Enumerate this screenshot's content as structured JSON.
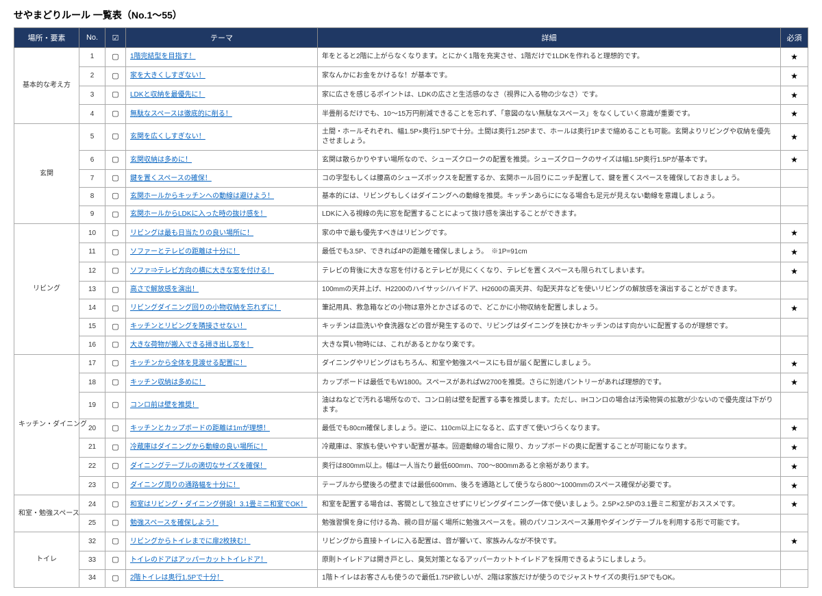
{
  "title": "せやまどりルール 一覧表（No.1〜55）",
  "headers": {
    "category": "場所・要素",
    "no": "No.",
    "check": "☑",
    "theme": "テーマ",
    "detail": "詳細",
    "required": "必須"
  },
  "check_glyph": "▢",
  "star_glyph": "★",
  "sections": [
    {
      "category": "基本的な考え方",
      "rows": [
        {
          "no": "1",
          "theme": "1階完結型を目指す！",
          "detail": "年をとると2階に上がらなくなります。とにかく1階を充実させ、1階だけで1LDKを作れると理想的です。",
          "req": true
        },
        {
          "no": "2",
          "theme": "家を大きくしすぎない！",
          "detail": "家なんかにお金をかけるな！が基本です。",
          "req": true
        },
        {
          "no": "3",
          "theme": "LDKと収納を最優先に！",
          "detail": "家に広さを感じるポイントは、LDKの広さと生活感のなさ（視界に入る物の少なさ）です。",
          "req": true
        },
        {
          "no": "4",
          "theme": "無駄なスペースは徹底的に削る！",
          "detail": "半畳削るだけでも、10〜15万円削減できることを忘れず、「意図のない無駄なスペース」をなくしていく意識が重要です。",
          "req": true
        }
      ]
    },
    {
      "category": "玄関",
      "rows": [
        {
          "no": "5",
          "theme": "玄関を広くしすぎない！",
          "detail": "土間・ホールそれぞれ、幅1.5P×奥行1.5Pで十分。土間は奥行1.25Pまで、ホールは奥行1Pまで縮めることも可能。玄関よりリビングや収納を優先させましょう。",
          "req": true
        },
        {
          "no": "6",
          "theme": "玄関収納は多めに！",
          "detail": "玄関は散らかりやすい場所なので、シューズクロークの配置を推奨。シューズクロークのサイズは幅1.5P奥行1.5Pが基本です。",
          "req": true
        },
        {
          "no": "7",
          "theme": "鍵を置くスペースの確保！",
          "detail": "コの字型もしくは腰高のシューズボックスを配置するか、玄関ホール回りにニッチ配置して、鍵を置くスペースを確保しておきましょう。",
          "req": false
        },
        {
          "no": "8",
          "theme": "玄関ホールからキッチンへの動線は避けよう！",
          "detail": "基本的には、リビングもしくはダイニングへの動線を推奨。キッチンあらにになる場合も足元が見えない動線を意識しましょう。",
          "req": false
        },
        {
          "no": "9",
          "theme": "玄関ホールからLDKに入った時の抜け感を！",
          "detail": "LDKに入る視線の先に窓を配置することによって抜け感を演出することができます。",
          "req": false
        }
      ]
    },
    {
      "category": "リビング",
      "rows": [
        {
          "no": "10",
          "theme": "リビングは最も日当たりの良い場所に！",
          "detail": "家の中で最も優先すべきはリビングです。",
          "req": true
        },
        {
          "no": "11",
          "theme": "ソファーとテレビの距離は十分に！",
          "detail": "最低でも3.5P、できれば4Pの距離を確保しましょう。　※1P=91cm",
          "req": true
        },
        {
          "no": "12",
          "theme": "ソファ⇒テレビ方向の横に大きな窓を付ける！",
          "detail": "テレビの背後に大きな窓を付けるとテレビが見にくくなり、テレビを置くスペースも限られてしまいます。",
          "req": true
        },
        {
          "no": "13",
          "theme": "高さで解放感を演出！",
          "detail": "100mmの天井上げ、H2200のハイサッシ/ハイドア、H2600の高天井、勾配天井などを使いリビングの解放感を演出することができます。",
          "req": false
        },
        {
          "no": "14",
          "theme": "リビングダイニング回りの小物収納を忘れずに！",
          "detail": "筆記用具、救急箱などの小物は意外とかさばるので、どこかに小物収納を配置しましょう。",
          "req": true
        },
        {
          "no": "15",
          "theme": "キッチンとリビングを隣接させない！",
          "detail": "キッチンは皿洗いや食洗器などの音が発生するので、リビングはダイニングを挟むかキッチンのはす向かいに配置するのが理想です。",
          "req": false
        },
        {
          "no": "16",
          "theme": "大きな荷物が搬入できる掃き出し窓を！",
          "detail": "大きな買い物時には、これがあるとかなり楽です。",
          "req": false
        }
      ]
    },
    {
      "category": "キッチン・ダイニング",
      "rows": [
        {
          "no": "17",
          "theme": "キッチンから全体を見渡せる配置に！",
          "detail": "ダイニングやリビングはもちろん、和室や勉強スペースにも目が届く配置にしましょう。",
          "req": true
        },
        {
          "no": "18",
          "theme": "キッチン収納は多めに！",
          "detail": "カップボードは最低でもW1800。スペースがあればW2700を推奨。さらに別途パントリーがあれば理想的です。",
          "req": true
        },
        {
          "no": "19",
          "theme": "コンロ前は壁を推奨！",
          "detail": "油はねなどで汚れる場所なので、コンロ前は壁を配置する事を推奨します。ただし、IHコンロの場合は汚染物質の拡散が少ないので優先度は下がります。",
          "req": false
        },
        {
          "no": "20",
          "theme": "キッチンとカップボードの距離は1mが理想！",
          "detail": "最低でも80cm確保しましょう。逆に、110cm以上になると、広すぎて使いづらくなります。",
          "req": true
        },
        {
          "no": "21",
          "theme": "冷蔵庫はダイニングから動線の良い場所に！",
          "detail": "冷蔵庫は、家族も使いやすい配置が基本。回遊動線の場合に限り、カップボードの奥に配置することが可能になります。",
          "req": true
        },
        {
          "no": "22",
          "theme": "ダイニングテーブルの適切なサイズを確保！",
          "detail": "奥行は800mm以上。幅は一人当たり最低600mm、700〜800mmあると余裕があります。",
          "req": true
        },
        {
          "no": "23",
          "theme": "ダイニング周りの通路幅を十分に！",
          "detail": "テーブルから壁後ろの壁までは最低600mm、後ろを通路として使うなら800〜1000mmのスペース確保が必要です。",
          "req": true
        }
      ]
    },
    {
      "category": "和室・勉強スペース",
      "rows": [
        {
          "no": "24",
          "theme": "和室はリビング・ダイニング併設！3.1畳ミニ和室でOK！",
          "detail": "和室を配置する場合は、客間として独立させずにリビングダイニング一体で使いましょう。2.5P×2.5Pの3.1畳ミニ和室がおススメです。",
          "req": true
        },
        {
          "no": "25",
          "theme": "勉強スペースを確保しよう！",
          "detail": "勉強習慣を身に付ける為、親の目が届く場所に勉強スペースを。親のパソコンスペース兼用やダイングテーブルを利用する形で可能です。",
          "req": false
        }
      ]
    },
    {
      "category": "トイレ",
      "rows": [
        {
          "no": "32",
          "theme": "リビングからトイレまでに扉2枚挟む！",
          "detail": "リビングから直接トイレに入る配置は、音が響いて、家族みんなが不快です。",
          "req": true
        },
        {
          "no": "33",
          "theme": "トイレのドアはアッパーカットトイレドア！",
          "detail": "原則トイレドアは開き戸とし、臭気対策となるアッパーカットトイレドアを採用できるようにしましょう。",
          "req": false
        },
        {
          "no": "34",
          "theme": "2階トイレは奥行1.5Pで十分！",
          "detail": "1階トイレはお客さんも使うので最低1.75P欲しいが、2階は家族だけが使うのでジャストサイズの奥行1.5PでもOK。",
          "req": false
        }
      ]
    }
  ]
}
